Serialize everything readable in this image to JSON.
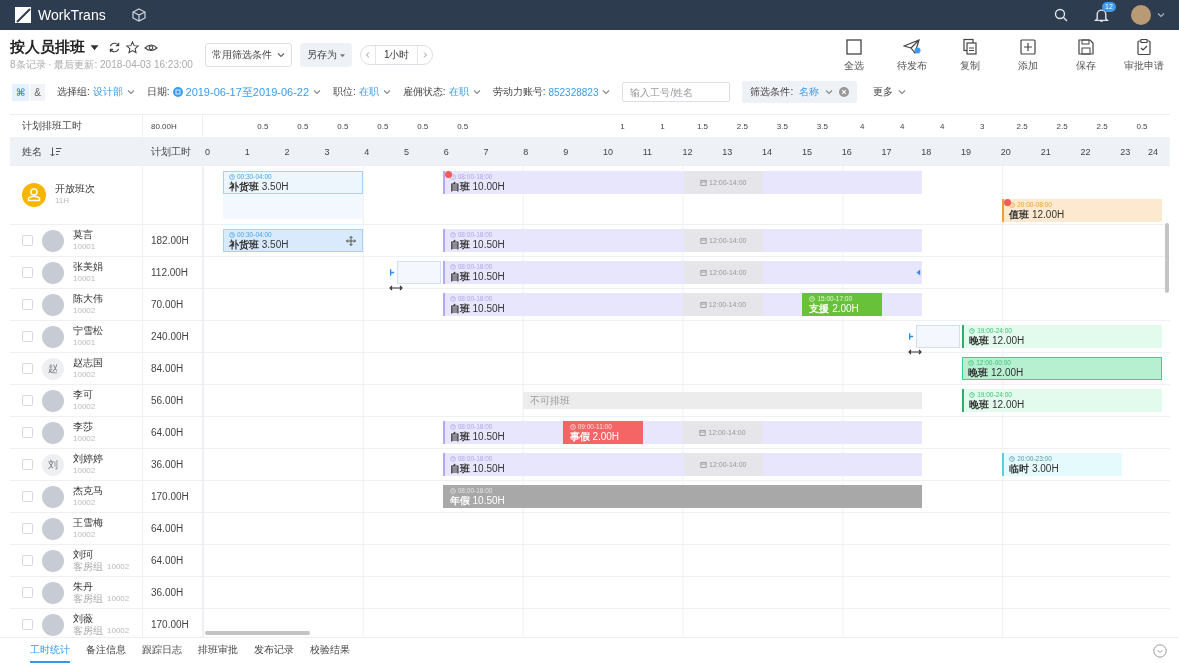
{
  "top_bar": {
    "brand": "WorkTrans",
    "notification_count": "12"
  },
  "header": {
    "title": "按人员排班",
    "subtitle": "8条记录 · 最后更新: 2018-04-03 16:23:00",
    "filter_preset": "常用筛选条件",
    "save_as": "另存为",
    "pager": "1小时",
    "toolbar": [
      {
        "kind": "select-all",
        "label": "全选"
      },
      {
        "kind": "publish",
        "label": "待发布"
      },
      {
        "kind": "copy",
        "label": "复制"
      },
      {
        "kind": "add",
        "label": "添加"
      },
      {
        "kind": "save",
        "label": "保存"
      },
      {
        "kind": "approve",
        "label": "审批申请"
      }
    ]
  },
  "filters": {
    "mode_toggle": [
      {
        "label": "⌘",
        "selected": true
      },
      {
        "label": "&",
        "selected": false
      }
    ],
    "fields": [
      {
        "label": "选择组:",
        "value": "设计部",
        "kind": "plain"
      },
      {
        "label": "日期:",
        "value": "2019-06-17至2019-06-22",
        "kind": "date"
      },
      {
        "label": "职位:",
        "value": "在职",
        "kind": "plain"
      },
      {
        "label": "雇佣状态:",
        "value": "在职",
        "kind": "plain"
      },
      {
        "label": "劳动力账号:",
        "value": "852328823",
        "kind": "plain"
      }
    ],
    "search_placeholder": "输入工号/姓名",
    "condition": {
      "label": "筛选条件:",
      "value": "名称"
    },
    "more": "更多"
  },
  "table": {
    "summary": {
      "label": "计划排班工时",
      "total": "80.00H",
      "hourly": [
        [
          "0.5",
          "0.5",
          "0.5",
          "0.5",
          "0.5",
          "0.5"
        ],
        [
          "1",
          "1",
          "1.5",
          "2.5",
          "3.5",
          "3.5",
          "4",
          "4",
          "4",
          "3",
          "2.5",
          "2.5",
          "2.5",
          "0.5"
        ]
      ]
    },
    "columns": {
      "name": "姓名",
      "hours": "计划工时"
    },
    "hours": [
      "0",
      "1",
      "2",
      "3",
      "4",
      "5",
      "6",
      "7",
      "8",
      "9",
      "10",
      "11",
      "12",
      "13",
      "14",
      "15",
      "16",
      "17",
      "18",
      "19",
      "20",
      "21",
      "22",
      "23",
      "24"
    ],
    "open_shifts": {
      "name": "开放班次",
      "sub": "11H",
      "lanes": [
        [
          {
            "kind": "supply",
            "time": "00:30-04:00",
            "name": "补货班",
            "hours": "3.50H",
            "selected": false,
            "highlighted": true
          },
          {
            "kind": "day",
            "time": "08:00-18:00",
            "name": "自班",
            "hours": "10.00H",
            "selected": false,
            "alert": true,
            "break": {
              "time": "12:00-14:00"
            }
          }
        ],
        [
          {
            "kind": "duty",
            "time": "20:00-08:00",
            "name": "值班",
            "hours": "12.00H",
            "selected": false,
            "alert": true
          }
        ]
      ]
    },
    "rows": [
      {
        "name": "莫言",
        "id": "10001",
        "planned": "182.00H",
        "checked": false,
        "avatar": {
          "kind": "photo"
        },
        "shifts": [
          {
            "kind": "supply",
            "time": "00:30-04:00",
            "name": "补货班",
            "hours": "3.50H",
            "selected": true
          },
          {
            "kind": "day",
            "time": "08:00-18:00",
            "name": "自班",
            "hours": "10.50H",
            "selected": false,
            "break": {
              "time": "12:00-14:00"
            }
          }
        ]
      },
      {
        "name": "张美娟",
        "id": "10001",
        "planned": "112.00H",
        "checked": false,
        "avatar": {
          "kind": "photo"
        },
        "shifts": [
          {
            "kind": "day",
            "time": "08:00-18:00",
            "name": "自班",
            "hours": "10.50H",
            "selected": false,
            "end_handle": true,
            "dragging": true,
            "break": {
              "time": "12:00-14:00"
            }
          }
        ]
      },
      {
        "name": "陈大伟",
        "id": "10002",
        "planned": "70.00H",
        "checked": false,
        "avatar": {
          "kind": "photo"
        },
        "shifts": [
          {
            "kind": "day",
            "time": "08:00-18:00",
            "name": "自班",
            "hours": "10.50H",
            "selected": false,
            "break": {
              "time": "12:00-14:00"
            }
          },
          {
            "kind": "support",
            "time": "15:00-17:00",
            "name": "支援",
            "hours": "2.00H",
            "selected": false
          }
        ]
      },
      {
        "name": "宁雪松",
        "id": "10001",
        "planned": "240.00H",
        "checked": false,
        "avatar": {
          "kind": "photo"
        },
        "shifts": [
          {
            "kind": "night",
            "time": "19:00-24:00",
            "name": "晚班",
            "hours": "12.00H",
            "selected": false,
            "dragging": true
          }
        ]
      },
      {
        "name": "赵志国",
        "id": "10002",
        "planned": "84.00H",
        "checked": false,
        "avatar": {
          "kind": "initial",
          "text": "赵"
        },
        "shifts": [
          {
            "kind": "night-strong",
            "time": "12:00-00:00",
            "name": "晚班",
            "hours": "12.00H",
            "selected": false
          }
        ]
      },
      {
        "name": "李可",
        "id": "10002",
        "planned": "56.00H",
        "checked": false,
        "avatar": {
          "kind": "photo"
        },
        "shifts": [
          {
            "kind": "unavailable",
            "name": "不可排班",
            "selected": false
          },
          {
            "kind": "night",
            "time": "19:00-24:00",
            "name": "晚班",
            "hours": "12.00H",
            "selected": false
          }
        ]
      },
      {
        "name": "李莎",
        "id": "10002",
        "planned": "64.00H",
        "checked": false,
        "avatar": {
          "kind": "photo"
        },
        "shifts": [
          {
            "kind": "day",
            "time": "08:00-18:00",
            "name": "自班",
            "hours": "10.50H",
            "selected": false,
            "break": {
              "time": "12:00-14:00"
            }
          },
          {
            "kind": "leave",
            "time": "09:00-11:00",
            "name": "事假",
            "hours": "2.00H",
            "selected": false
          }
        ]
      },
      {
        "name": "刘婷婷",
        "id": "10002",
        "planned": "36.00H",
        "checked": false,
        "avatar": {
          "kind": "initial",
          "text": "刘"
        },
        "shifts": [
          {
            "kind": "day",
            "time": "08:00-18:00",
            "name": "自班",
            "hours": "10.50H",
            "selected": false,
            "break": {
              "time": "12:00-14:00"
            }
          },
          {
            "kind": "temp",
            "time": "20:00-23:00",
            "name": "临时",
            "hours": "3.00H",
            "selected": false
          }
        ]
      },
      {
        "name": "杰克马",
        "id": "10002",
        "planned": "170.00H",
        "checked": false,
        "avatar": {
          "kind": "photo"
        },
        "shifts": [
          {
            "kind": "annual",
            "time": "08:00-18:00",
            "name": "年假",
            "hours": "10.50H",
            "selected": false
          }
        ]
      },
      {
        "name": "王雪梅",
        "id": "10002",
        "planned": "64.00H",
        "checked": false,
        "avatar": {
          "kind": "photo"
        }
      },
      {
        "name": "刘珂",
        "group": "客房组",
        "id": "10002",
        "planned": "64.00H",
        "checked": false,
        "avatar": {
          "kind": "photo"
        }
      },
      {
        "name": "朱丹",
        "group": "客房组",
        "id": "10002",
        "planned": "36.00H",
        "checked": false,
        "avatar": {
          "kind": "photo"
        }
      },
      {
        "name": "刘薇",
        "group": "客房组",
        "id": "10002",
        "planned": "170.00H",
        "checked": false,
        "avatar": {
          "kind": "photo"
        }
      }
    ]
  },
  "bottom_tabs": [
    {
      "label": "工时统计",
      "selected": true
    },
    {
      "label": "备注信息",
      "selected": false
    },
    {
      "label": "跟踪日志",
      "selected": false
    },
    {
      "label": "排班审批",
      "selected": false
    },
    {
      "label": "发布记录",
      "selected": false
    },
    {
      "label": "校验结果",
      "selected": false
    }
  ]
}
